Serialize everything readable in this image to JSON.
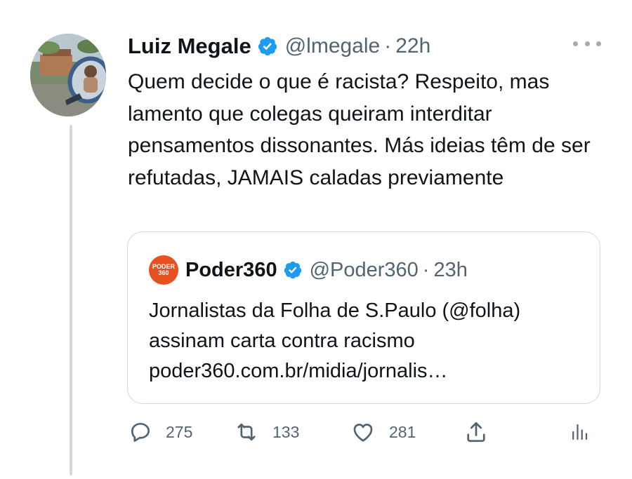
{
  "tweet": {
    "author_name": "Luiz Megale",
    "handle": "@lmegale",
    "separator": "·",
    "time": "22h",
    "text": "Quem decide o que é racista? Respeito, mas lamento que colegas queiram interditar pensamentos dissonantes. Más ideias têm de ser refutadas, JAMAIS caladas previamente",
    "avatar_icon": "profile-photo",
    "verified_icon": "verified-badge-icon",
    "more_icon": "more-options-icon"
  },
  "quote": {
    "author_name": "Poder360",
    "avatar_text_top": "PODER",
    "avatar_text_bottom": "360",
    "handle": "@Poder360",
    "separator": "·",
    "time": "23h",
    "text": "Jornalistas da Folha de S.Paulo (@folha) assinam carta contra racismo poder360.com.br/midia/jornalis…"
  },
  "actions": {
    "replies": "275",
    "retweets": "133",
    "likes": "281"
  },
  "colors": {
    "text_primary": "#0f1419",
    "text_secondary": "#536471",
    "verified_blue": "#1d9bf0",
    "border": "#cfd9de",
    "poder_orange": "#e8501f"
  }
}
